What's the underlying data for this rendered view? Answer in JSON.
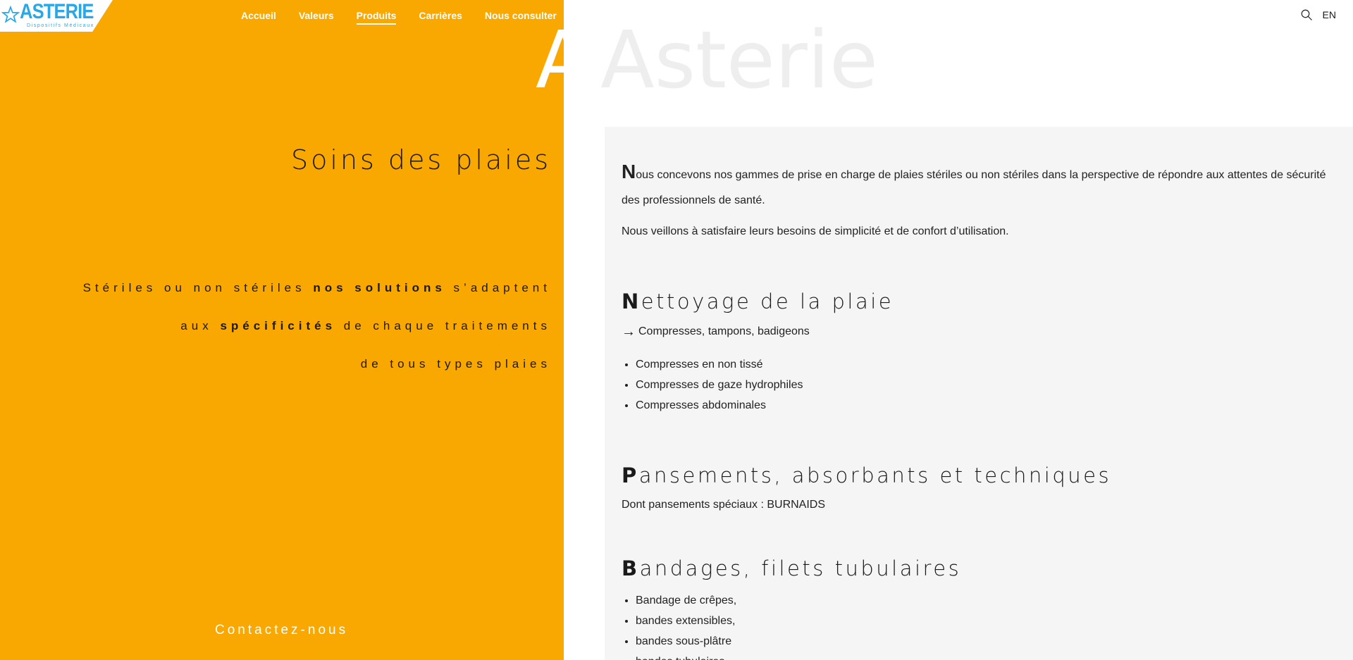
{
  "brand": {
    "name": "ASTERIE",
    "subtitle": "Dispositifs Médicaux",
    "color": "#2aa8e6"
  },
  "nav": {
    "items": [
      {
        "label": "Accueil",
        "active": false
      },
      {
        "label": "Valeurs",
        "active": false
      },
      {
        "label": "Produits",
        "active": true
      },
      {
        "label": "Carrières",
        "active": false
      },
      {
        "label": "Nous consulter",
        "active": false
      }
    ]
  },
  "topbar": {
    "search_icon": "search-icon",
    "lang": "EN"
  },
  "hero": {
    "watermark_left": "A",
    "watermark_right": "Asterie",
    "title": "Soins des plaies",
    "tagline": {
      "line1_pre": "Stériles ou non stériles ",
      "line1_bold": "nos solutions",
      "line1_post": " s’adaptent",
      "line2_pre": "aux ",
      "line2_bold": "spécificités",
      "line2_post": " de chaque traitements",
      "line3": "de tous types plaies"
    },
    "contact": "Contactez-nous",
    "accent": "#f8a800"
  },
  "content": {
    "intro": {
      "p1_cap": "N",
      "p1_rest": "ous concevons nos gammes de prise en charge de plaies stériles ou non stériles dans la perspective de répondre aux attentes de sécurité des professionnels de santé.",
      "p2": "Nous veillons à satisfaire leurs besoins de simplicité et de confort d’utilisation."
    },
    "sections": [
      {
        "cap": "N",
        "title_rest": "ettoyage de la plaie",
        "sub": "Compresses, tampons, badigeons",
        "sub_icon": "arrow-right-icon",
        "items": [
          "Compresses en non tissé",
          "Compresses de gaze hydrophiles",
          "Compresses abdominales"
        ]
      },
      {
        "cap": "P",
        "title_rest": "ansements, absorbants et techniques",
        "sub": "Dont pansements spéciaux : BURNAIDS"
      },
      {
        "cap": "B",
        "title_rest": "andages, filets tubulaires",
        "items": [
          "Bandage de crêpes,",
          "bandes extensibles,",
          "bandes sous-plâtre",
          "bandes tubulaires"
        ]
      }
    ]
  }
}
